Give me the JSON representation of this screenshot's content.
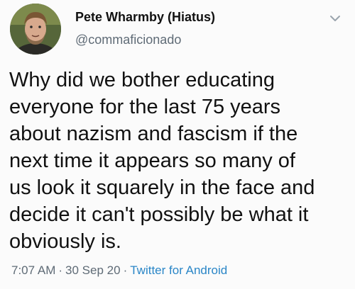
{
  "user": {
    "display_name": "Pete Wharmby (Hiatus)",
    "handle": "@commaficionado"
  },
  "menu_icon": "chevron-down-icon",
  "tweet": {
    "lines": [
      "Why did we bother educating",
      "everyone for the last 75 years",
      "about nazism and fascism if the",
      "next time it appears so many of",
      "us look it squarely in the face and",
      "decide it can't possibly be what it",
      "obviously is."
    ]
  },
  "meta": {
    "time": "7:07 AM",
    "separator": "·",
    "date": "30 Sep 20",
    "source": "Twitter for Android"
  },
  "colors": {
    "background": "#fbfbfb",
    "text": "#111111",
    "secondary": "#5f6b76",
    "link": "#2a86c7"
  }
}
